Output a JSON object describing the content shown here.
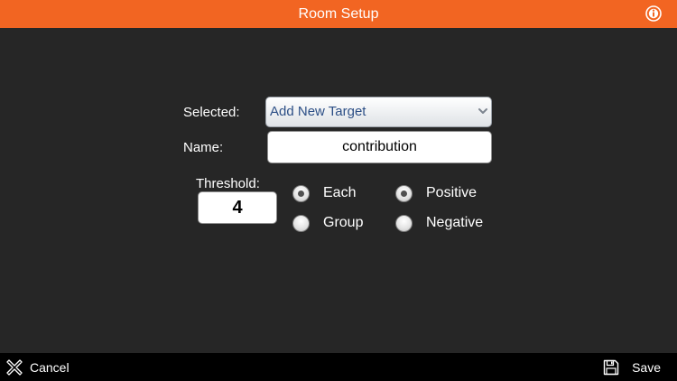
{
  "header": {
    "title": "Room Setup",
    "info_icon": "info-icon",
    "accent_color": "#f26522"
  },
  "form": {
    "selected_label": "Selected:",
    "selected_value": "Add New Target",
    "name_label": "Name:",
    "name_value": "contribution",
    "threshold_label": "Threshold:",
    "threshold_value": "4",
    "scope_options": [
      {
        "label": "Each",
        "checked": true
      },
      {
        "label": "Group",
        "checked": false
      }
    ],
    "polarity_options": [
      {
        "label": "Positive",
        "checked": true
      },
      {
        "label": "Negative",
        "checked": false
      }
    ]
  },
  "footer": {
    "cancel_label": "Cancel",
    "cancel_icon": "close-x-icon",
    "save_label": "Save",
    "save_icon": "floppy-disk-icon"
  }
}
